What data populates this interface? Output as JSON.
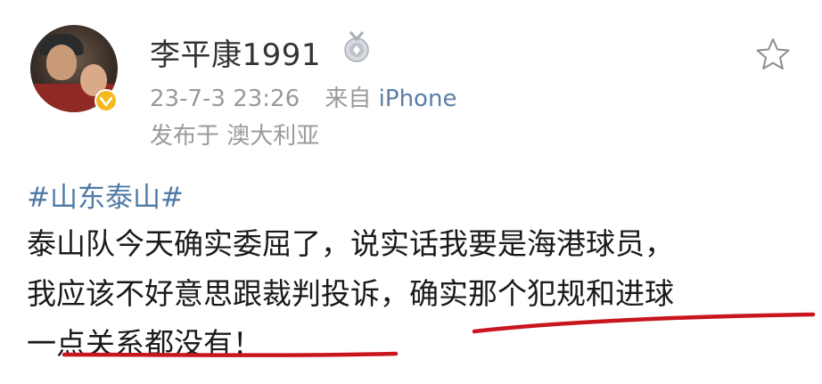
{
  "post": {
    "username": "李平康1991",
    "time": "23-7-3 23:26",
    "source_prefix": "来自",
    "source_device": "iPhone",
    "location": "发布于 澳大利亚",
    "hashtag": "#山东泰山#",
    "lines": [
      "泰山队今天确实委屈了，说实话我要是海港球员，",
      "我应该不好意思跟裁判投诉，确实那个犯规和进球",
      "一点关系都没有！"
    ]
  },
  "icons": {
    "verify": "verified-badge-icon",
    "rank": "medal-icon",
    "favorite": "star-icon"
  },
  "colors": {
    "hashtag": "#4f7aa6",
    "link": "#5b7fa8",
    "meta": "#9a9a9a",
    "verify_badge": "#f6b81f",
    "ink_underline": "#c9151e"
  }
}
